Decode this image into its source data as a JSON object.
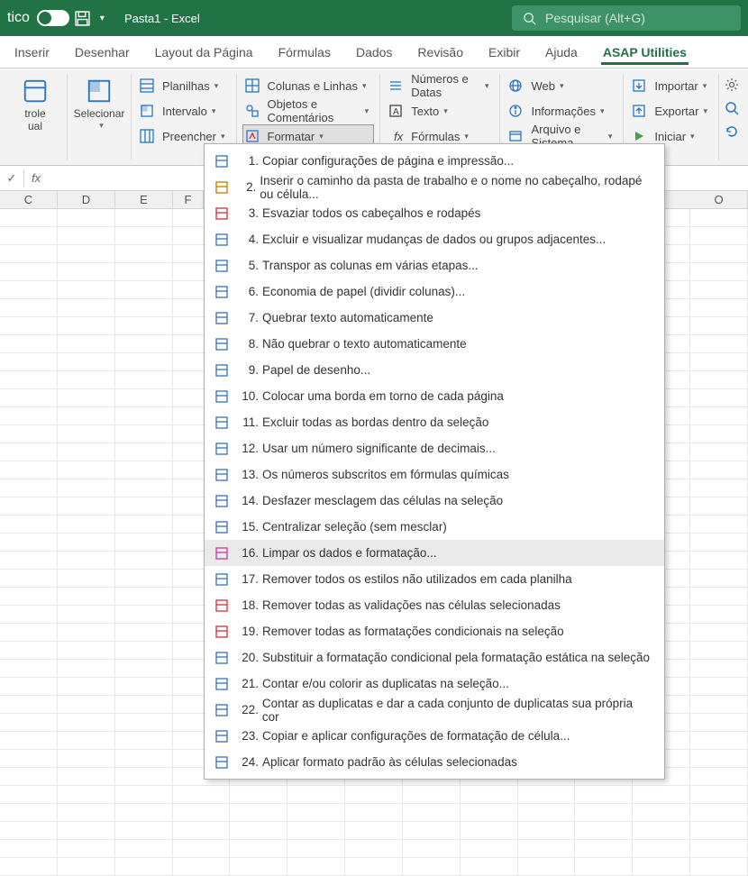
{
  "title": {
    "workbook": "Pasta1",
    "app": "Excel",
    "autosave_label": "tico"
  },
  "search": {
    "placeholder": "Pesquisar (Alt+G)"
  },
  "tabs": [
    {
      "label": "Inserir"
    },
    {
      "label": "Desenhar"
    },
    {
      "label": "Layout da Página"
    },
    {
      "label": "Fórmulas"
    },
    {
      "label": "Dados"
    },
    {
      "label": "Revisão"
    },
    {
      "label": "Exibir"
    },
    {
      "label": "Ajuda"
    },
    {
      "label": "ASAP Utilities"
    }
  ],
  "ribbon": {
    "trole": {
      "line1": "trole",
      "line2": "ual"
    },
    "selecionar": "Selecionar",
    "planilhas": "Planilhas",
    "intervalo": "Intervalo",
    "preencher": "Preencher",
    "colunas_linhas": "Colunas e Linhas",
    "objetos_comentarios": "Objetos e Comentários",
    "formatar": "Formatar",
    "numeros_datas": "Números e Datas",
    "texto": "Texto",
    "formulas": "Fórmulas",
    "web": "Web",
    "informacoes": "Informações",
    "arquivo_sistema": "Arquivo e Sistema",
    "importar": "Importar",
    "exportar": "Exportar",
    "iniciar": "Iniciar"
  },
  "columns": [
    "C",
    "D",
    "E",
    "F",
    "",
    "",
    "",
    "",
    "",
    "",
    "",
    "O"
  ],
  "menu": [
    {
      "n": "1.",
      "t": "Copiar configurações de página e impressão..."
    },
    {
      "n": "2.",
      "t": "Inserir o caminho da pasta de trabalho e o nome no cabeçalho, rodapé ou célula..."
    },
    {
      "n": "3.",
      "t": "Esvaziar todos os cabeçalhos e rodapés"
    },
    {
      "n": "4.",
      "t": "Excluir e visualizar mudanças de dados ou grupos adjacentes..."
    },
    {
      "n": "5.",
      "t": "Transpor as colunas em várias etapas..."
    },
    {
      "n": "6.",
      "t": "Economia de papel (dividir colunas)..."
    },
    {
      "n": "7.",
      "t": "Quebrar texto automaticamente"
    },
    {
      "n": "8.",
      "t": "Não quebrar o texto automaticamente"
    },
    {
      "n": "9.",
      "t": "Papel de desenho..."
    },
    {
      "n": "10.",
      "t": "Colocar uma borda em torno de cada página"
    },
    {
      "n": "11.",
      "t": "Excluir todas as bordas dentro da seleção"
    },
    {
      "n": "12.",
      "t": "Usar um número significante de decimais..."
    },
    {
      "n": "13.",
      "t": "Os números subscritos em fórmulas químicas"
    },
    {
      "n": "14.",
      "t": "Desfazer mesclagem das células na seleção"
    },
    {
      "n": "15.",
      "t": "Centralizar seleção (sem mesclar)"
    },
    {
      "n": "16.",
      "t": "Limpar os dados e formatação..."
    },
    {
      "n": "17.",
      "t": "Remover todos os estilos não utilizados em cada planilha"
    },
    {
      "n": "18.",
      "t": "Remover todas as validações nas células selecionadas"
    },
    {
      "n": "19.",
      "t": "Remover todas as formatações condicionais na seleção"
    },
    {
      "n": "20.",
      "t": "Substituir a formatação condicional pela formatação estática na seleção"
    },
    {
      "n": "21.",
      "t": "Contar e/ou colorir as duplicatas na seleção..."
    },
    {
      "n": "22.",
      "t": "Contar as duplicatas e dar a cada conjunto de duplicatas sua própria cor"
    },
    {
      "n": "23.",
      "t": "Copiar e aplicar configurações de formatação de célula..."
    },
    {
      "n": "24.",
      "t": "Aplicar formato padrão às células selecionadas"
    }
  ],
  "icon_colors": [
    "#3a6fb7",
    "#c27803",
    "#c33",
    "#3a6fb7",
    "#3a6fb7",
    "#3a6fb7",
    "#3a6fb7",
    "#3a6fb7",
    "#3a6fb7",
    "#3a6fb7",
    "#3a6fb7",
    "#3a6fb7",
    "#3a6fb7",
    "#3a6fb7",
    "#3a6fb7",
    "#c23ba0",
    "#3a6fb7",
    "#c33",
    "#c33",
    "#3a6fb7",
    "#3a6fb7",
    "#3a6fb7",
    "#3a6fb7",
    "#3a6fb7"
  ]
}
